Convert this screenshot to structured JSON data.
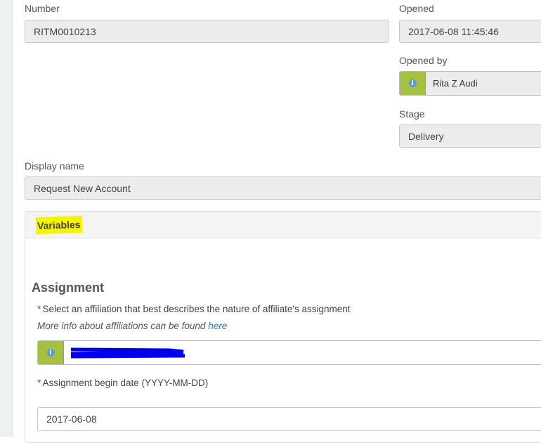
{
  "fields": {
    "number": {
      "label": "Number",
      "value": "RITM0010213"
    },
    "opened": {
      "label": "Opened",
      "value": "2017-06-08 11:45:46"
    },
    "opened_by": {
      "label": "Opened by",
      "value": "Rita Z Audi"
    },
    "stage": {
      "label": "Stage",
      "value": "Delivery"
    },
    "display_name": {
      "label": "Display name",
      "value": "Request New Account"
    }
  },
  "variables": {
    "header": "Variables",
    "section_title": "Assignment",
    "affiliation": {
      "required_mark": "*",
      "label": "Select an affiliation that best describes the nature of affiliate's assignment",
      "help_text": "More info about affiliations can be found",
      "help_link": "here"
    },
    "begin_date": {
      "required_mark": "*",
      "label": "Assignment begin date (YYYY-MM-DD)",
      "value": "2017-06-08"
    }
  },
  "colors": {
    "ref_button": "#a6c042",
    "highlight": "#f5f500",
    "link": "#2e75b6"
  }
}
